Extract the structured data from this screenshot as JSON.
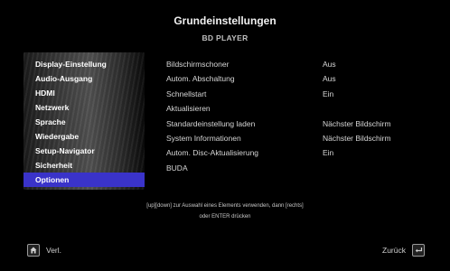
{
  "header": {
    "title": "Grundeinstellungen",
    "subtitle": "BD PLAYER"
  },
  "sidebar": {
    "items": [
      {
        "label": "Display-Einstellung",
        "selected": false
      },
      {
        "label": "Audio-Ausgang",
        "selected": false
      },
      {
        "label": "HDMI",
        "selected": false
      },
      {
        "label": "Netzwerk",
        "selected": false
      },
      {
        "label": "Sprache",
        "selected": false
      },
      {
        "label": "Wiedergabe",
        "selected": false
      },
      {
        "label": "Setup-Navigator",
        "selected": false
      },
      {
        "label": "Sicherheit",
        "selected": false
      },
      {
        "label": "Optionen",
        "selected": true
      }
    ],
    "selected_color": "#3a33c9"
  },
  "settings": {
    "rows": [
      {
        "label": "Bildschirmschoner",
        "value": "Aus"
      },
      {
        "label": "Autom. Abschaltung",
        "value": "Aus"
      },
      {
        "label": "Schnellstart",
        "value": "Ein"
      },
      {
        "label": "Aktualisieren",
        "value": ""
      },
      {
        "label": "Standardeinstellung laden",
        "value": "Nächster Bildschirm"
      },
      {
        "label": "System Informationen",
        "value": "Nächster Bildschirm"
      },
      {
        "label": "Autom. Disc-Aktualisierung",
        "value": "Ein"
      },
      {
        "label": "BUDA",
        "value": ""
      }
    ]
  },
  "help": {
    "line1": "[up][down] zur Auswahl eines Elements verwenden, dann [rechts]",
    "line2": "oder ENTER drücken"
  },
  "footer": {
    "left": {
      "label": "Verl.",
      "icon": "home-icon"
    },
    "right": {
      "label": "Zurück",
      "icon": "return-icon"
    }
  }
}
